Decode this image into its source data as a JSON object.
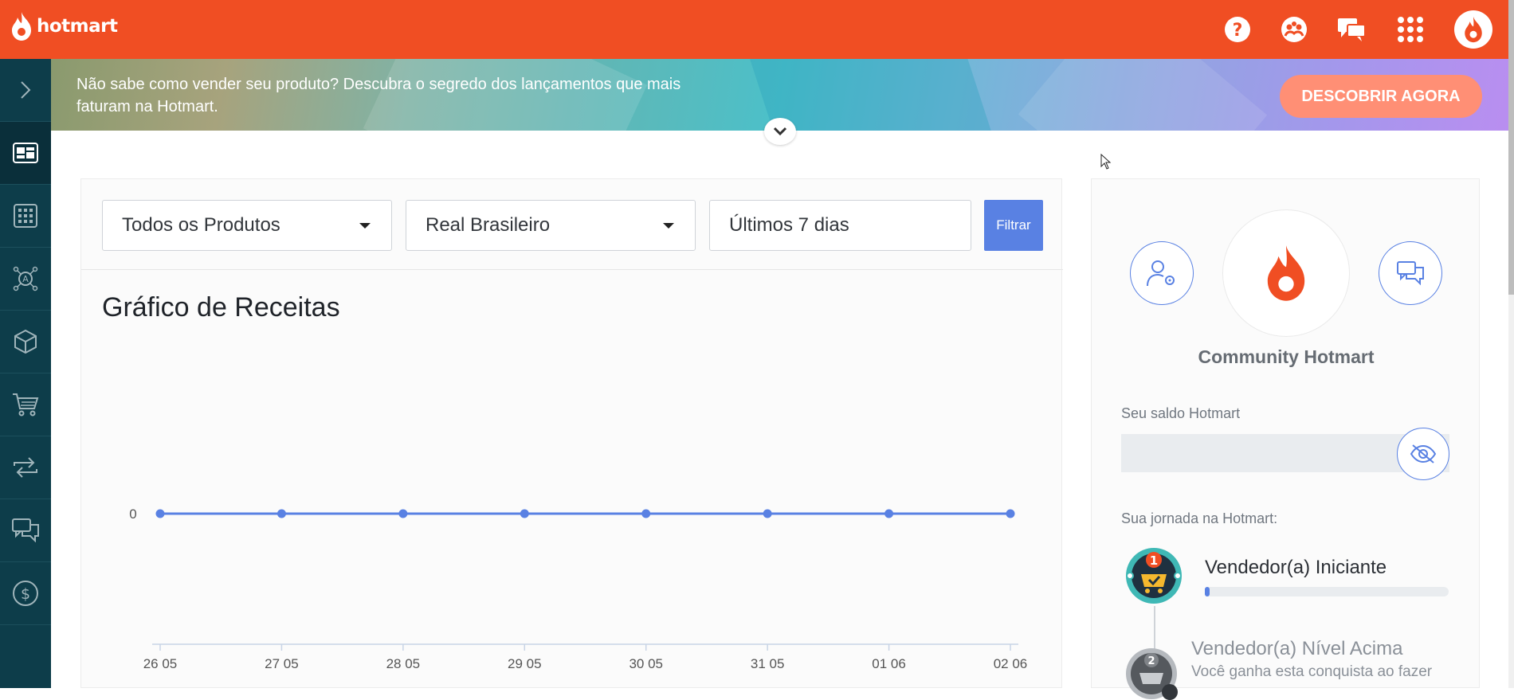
{
  "header": {
    "logo_text": "hotmart",
    "icons": [
      "help-icon",
      "community-icon",
      "chat-icon",
      "apps-grid-icon",
      "user-avatar-icon"
    ]
  },
  "sidebar": {
    "items": [
      {
        "icon": "expand-chevron-icon"
      },
      {
        "icon": "dashboard-icon",
        "active": true
      },
      {
        "icon": "apps-icon"
      },
      {
        "icon": "affiliates-network-icon"
      },
      {
        "icon": "product-box-icon"
      },
      {
        "icon": "shopping-cart-icon"
      },
      {
        "icon": "recurrence-icon"
      },
      {
        "icon": "messages-icon"
      },
      {
        "icon": "dollar-icon"
      }
    ]
  },
  "banner": {
    "text": "Não sabe como vender seu produto? Descubra o segredo dos lançamentos que mais faturam na Hotmart.",
    "button_label": "DESCOBRIR AGORA"
  },
  "filters": {
    "product": "Todos os Produtos",
    "currency": "Real Brasileiro",
    "period": "Últimos 7 dias",
    "button_label": "Filtrar"
  },
  "chart_data": {
    "type": "line",
    "title": "Gráfico de Receitas",
    "categories": [
      "26 05",
      "27 05",
      "28 05",
      "29 05",
      "30 05",
      "31 05",
      "01 06",
      "02 06"
    ],
    "series": [
      {
        "values": [
          0,
          0,
          0,
          0,
          0,
          0,
          0,
          0
        ]
      }
    ],
    "y_ticks": [
      "0"
    ],
    "xlabel": "",
    "ylabel": "",
    "color": "#5981e3"
  },
  "right_panel": {
    "community_title": "Community Hotmart",
    "balance_label": "Seu saldo Hotmart",
    "journey_label": "Sua jornada na Hotmart:",
    "level1": {
      "badge_number": "1",
      "name": "Vendedor(a) Iniciante",
      "progress": 0.02
    },
    "level2": {
      "badge_number": "2",
      "name": "Vendedor(a) Nível Acima",
      "description": "Você ganha esta conquista ao fazer"
    }
  },
  "colors": {
    "brand": "#f04e23",
    "accent": "#5981e3",
    "sidebar": "#0d3d4a"
  }
}
